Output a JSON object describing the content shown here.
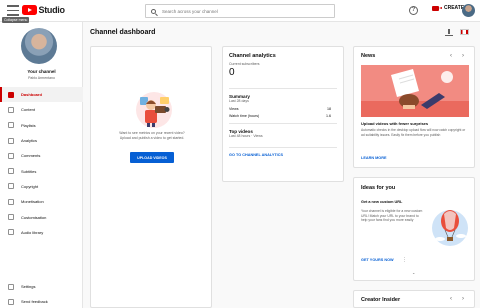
{
  "topbar": {
    "collapse_tooltip": "Collapse menu",
    "logo_text": "Studio",
    "search_placeholder": "Search across your channel",
    "help_symbol": "?",
    "create_label": "CREATE"
  },
  "sidebar": {
    "channel_name": "Your channel",
    "channel_owner": "Pablo Armentano",
    "items": [
      {
        "label": "Dashboard",
        "icon": "dashboard-icon",
        "active": true
      },
      {
        "label": "Content",
        "icon": "content-icon"
      },
      {
        "label": "Playlists",
        "icon": "playlists-icon"
      },
      {
        "label": "Analytics",
        "icon": "analytics-icon"
      },
      {
        "label": "Comments",
        "icon": "comments-icon"
      },
      {
        "label": "Subtitles",
        "icon": "subtitles-icon"
      },
      {
        "label": "Copyright",
        "icon": "copyright-icon"
      },
      {
        "label": "Monetisation",
        "icon": "monetisation-icon"
      },
      {
        "label": "Customisation",
        "icon": "customisation-icon"
      },
      {
        "label": "Audio library",
        "icon": "audio-library-icon"
      }
    ],
    "bottom_items": [
      {
        "label": "Settings",
        "icon": "gear-icon"
      },
      {
        "label": "Send feedback",
        "icon": "feedback-icon"
      }
    ]
  },
  "main": {
    "title": "Channel dashboard",
    "upload_card": {
      "text_line1": "Want to see metrics on your recent video?",
      "text_line2": "Upload and publish a video to get started.",
      "button_label": "UPLOAD VIDEOS"
    },
    "analytics_card": {
      "title": "Channel analytics",
      "subs_label": "Current subscribers",
      "subs_value": "0",
      "summary_title": "Summary",
      "summary_period": "Last 28 days",
      "views_label": "Views",
      "views_value": "18",
      "watch_label": "Watch time (hours)",
      "watch_value": "1.6",
      "top_title": "Top videos",
      "top_period": "Last 48 hours · Views",
      "link": "GO TO CHANNEL ANALYTICS"
    },
    "news_card": {
      "title": "News",
      "headline": "Upload videos with fewer surprises",
      "body": "Automatic checks in the desktop upload flow will now catch copyright or ad suitability issues. Easily fix them before you publish",
      "link": "LEARN MORE"
    },
    "ideas_card": {
      "title": "Ideas for you",
      "subtitle": "Get a new custom URL",
      "body": "Your channel is eligible for a new custom URL! Match your URL to your brand to help your fans find you more easily",
      "link": "GET YOURS NOW"
    },
    "creator_card": {
      "title": "Creator Insider"
    }
  },
  "colors": {
    "brand_red": "#ff0000",
    "active_red": "#cc0000",
    "link_blue": "#065fd4",
    "news_bg": "#f28b82"
  }
}
